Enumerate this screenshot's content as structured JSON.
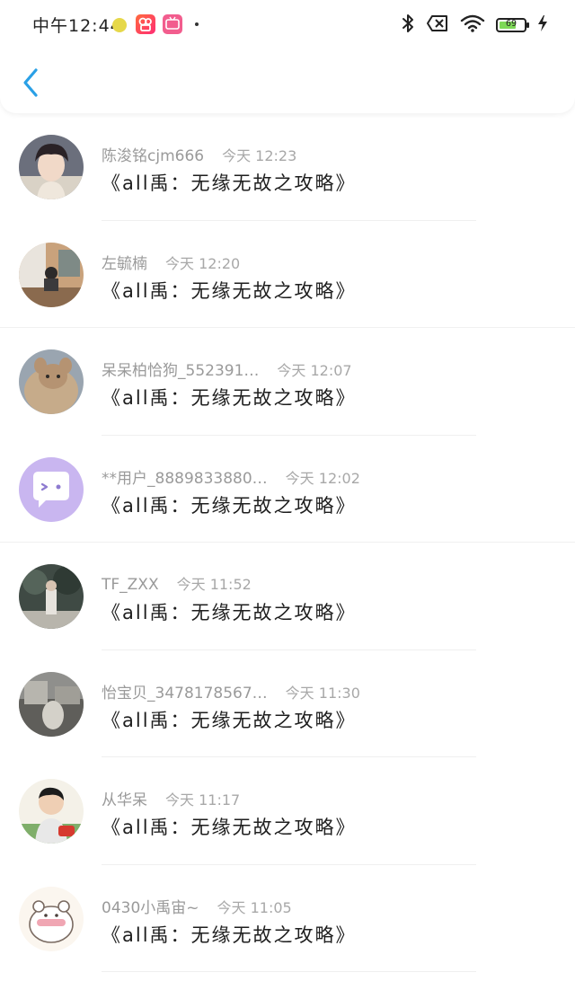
{
  "status_bar": {
    "time": "中午12:44",
    "battery_level": "69",
    "battery_fraction": 0.69
  },
  "header": {
    "back_icon": "chevron-left-icon"
  },
  "colors": {
    "accent": "#2aa0e6",
    "username": "#9a9a9a",
    "time": "#a8a8a8",
    "content": "#1e1e1e"
  },
  "comments": [
    {
      "username": "陈浚铭cjm666",
      "time": "今天 12:23",
      "content": "《all禹：无缘无故之攻略》"
    },
    {
      "username": "左毓楠",
      "time": "今天 12:20",
      "content": "《all禹：无缘无故之攻略》"
    },
    {
      "username": "呆呆柏恰狗_552391…",
      "time": "今天 12:07",
      "content": "《all禹：无缘无故之攻略》"
    },
    {
      "username": "**用户_8889833880…",
      "time": "今天 12:02",
      "content": "《all禹：无缘无故之攻略》"
    },
    {
      "username": "TF_ZXX",
      "time": "今天 11:52",
      "content": "《all禹：无缘无故之攻略》"
    },
    {
      "username": "怡宝贝_3478178567…",
      "time": "今天 11:30",
      "content": "《all禹：无缘无故之攻略》"
    },
    {
      "username": "从华呆",
      "time": "今天 11:17",
      "content": "《all禹：无缘无故之攻略》"
    },
    {
      "username": "0430小禹宙~",
      "time": "今天 11:05",
      "content": "《all禹：无缘无故之攻略》"
    }
  ]
}
